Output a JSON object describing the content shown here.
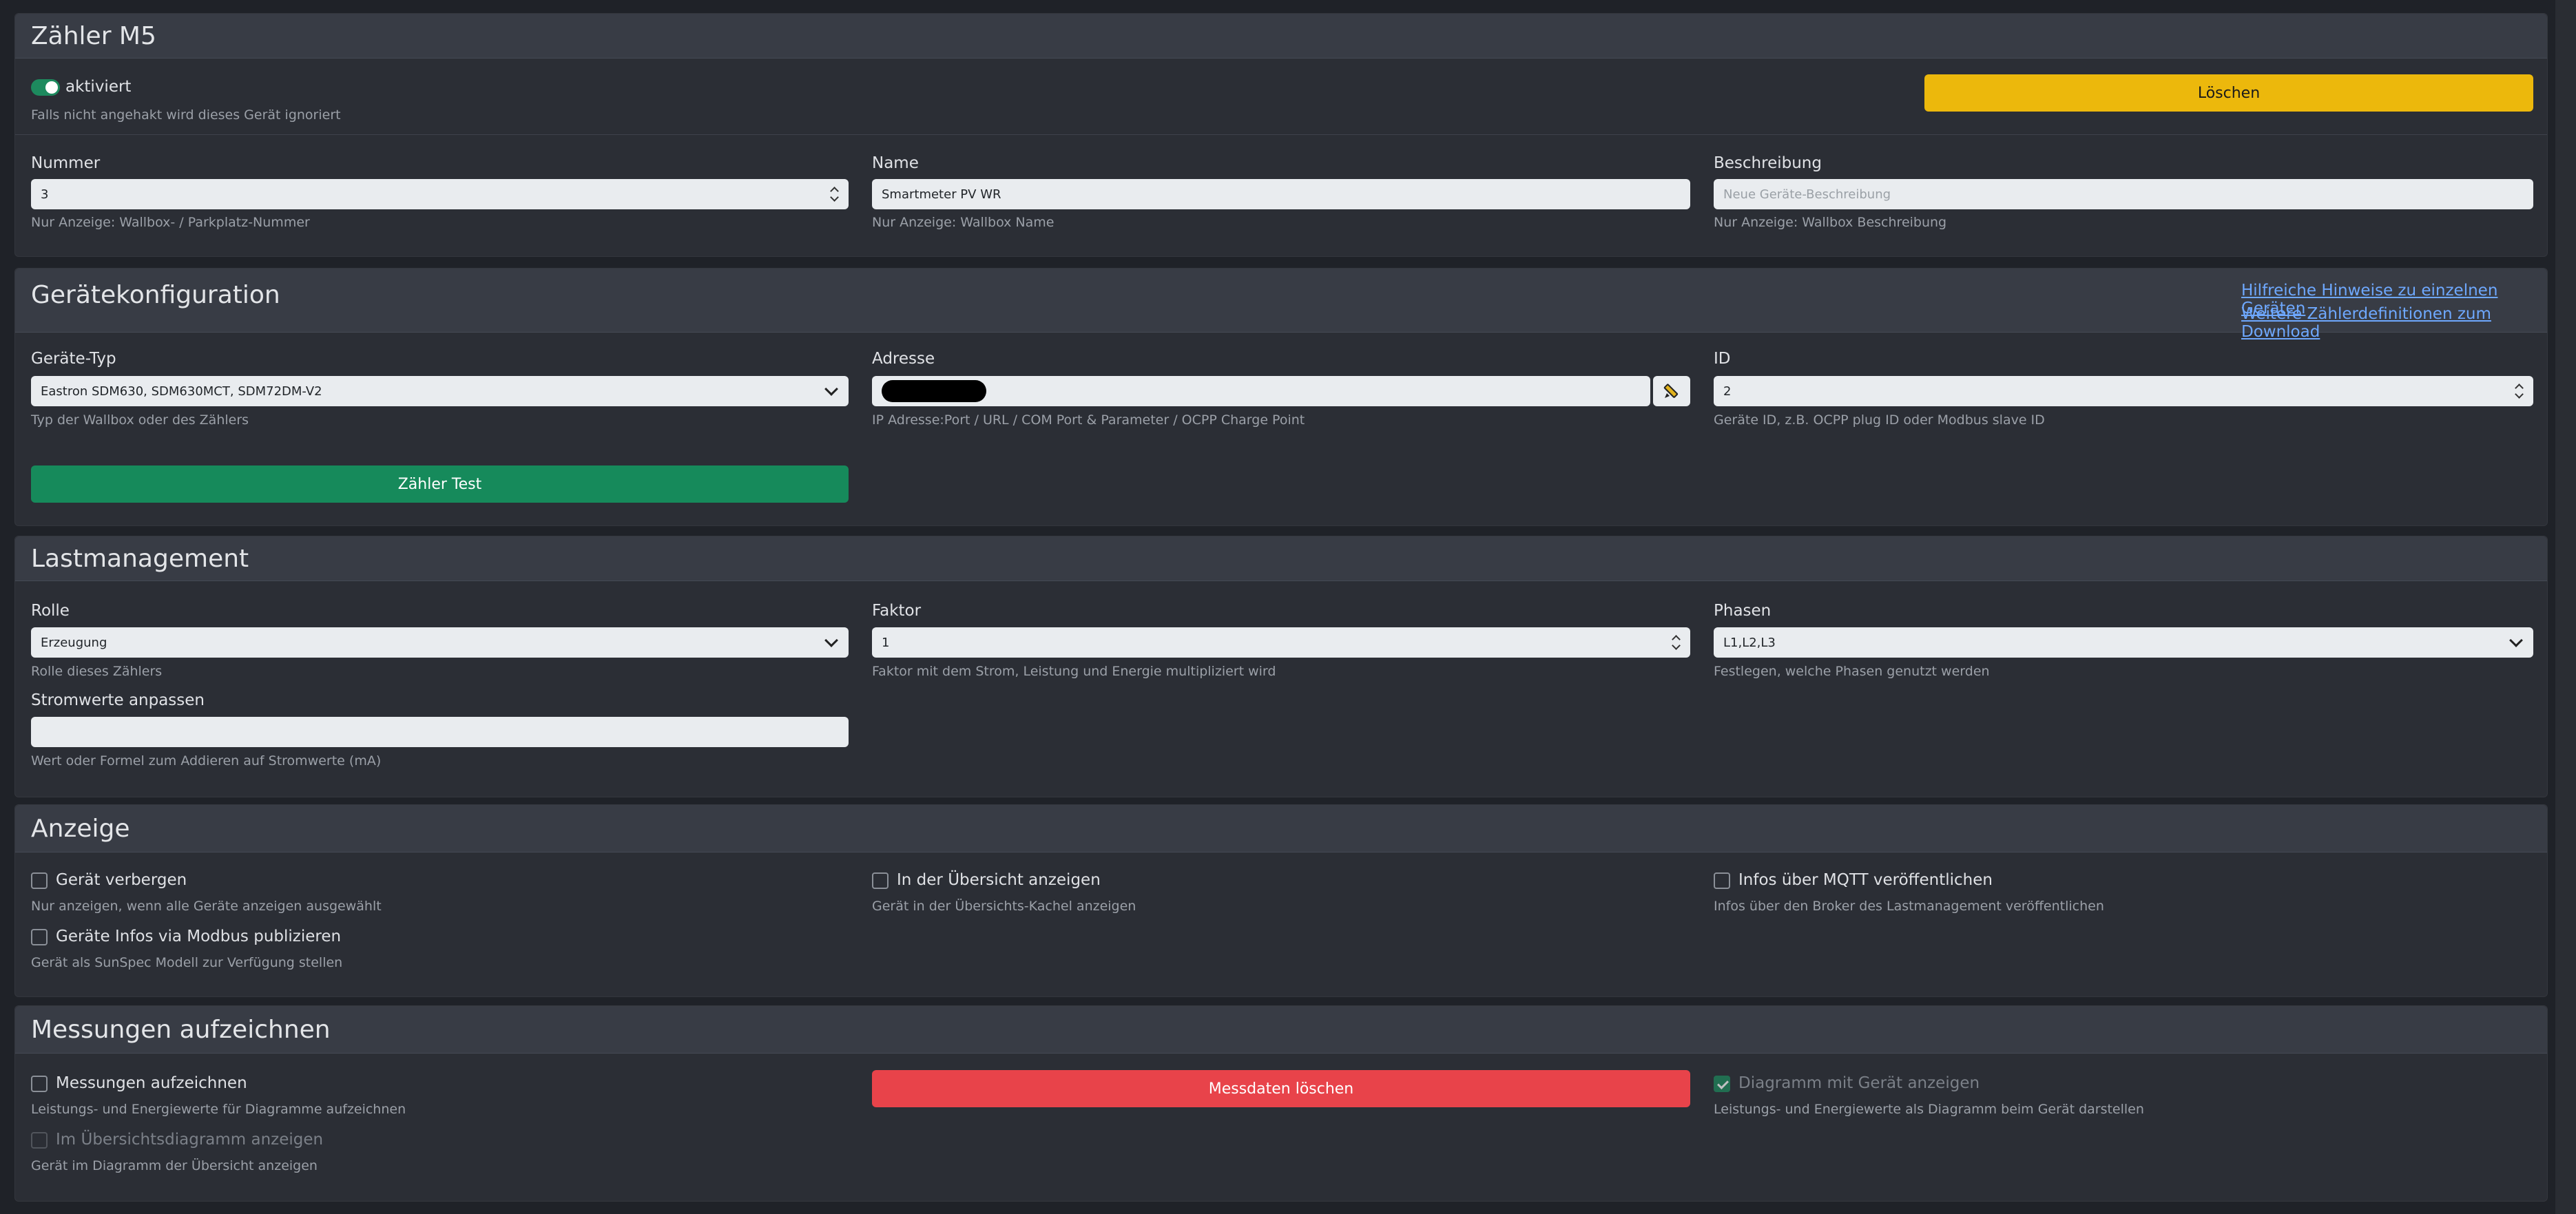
{
  "device": {
    "title": "Zähler M5",
    "active_label": "aktiviert",
    "active_help": "Falls nicht angehakt wird dieses Gerät ignoriert",
    "delete_button": "Löschen",
    "number_label": "Nummer",
    "number_value": "3",
    "number_help": "Nur Anzeige: Wallbox- / Parkplatz-Nummer",
    "name_label": "Name",
    "name_value": "Smartmeter PV WR",
    "name_help": "Nur Anzeige: Wallbox Name",
    "desc_label": "Beschreibung",
    "desc_placeholder": "Neue Geräte-Beschreibung",
    "desc_help": "Nur Anzeige: Wallbox Beschreibung"
  },
  "config": {
    "title": "Gerätekonfiguration",
    "link_hints": "Hilfreiche Hinweise zu einzelnen Geräten",
    "link_download": "Weitere Zählerdefinitionen zum Download",
    "type_label": "Geräte-Typ",
    "type_value": "Eastron SDM630, SDM630MCT, SDM72DM-V2",
    "type_help": "Typ der Wallbox oder des Zählers",
    "address_label": "Adresse",
    "address_help": "IP Adresse:Port / URL / COM Port & Parameter / OCPP Charge Point",
    "id_label": "ID",
    "id_value": "2",
    "id_help": "Geräte ID, z.B. OCPP plug ID oder Modbus slave ID",
    "test_button": "Zähler Test"
  },
  "load": {
    "title": "Lastmanagement",
    "role_label": "Rolle",
    "role_value": "Erzeugung",
    "role_help": "Rolle dieses Zählers",
    "factor_label": "Faktor",
    "factor_value": "1",
    "factor_help": "Faktor mit dem Strom, Leistung und Energie multipliziert wird",
    "phases_label": "Phasen",
    "phases_value": "L1,L2,L3",
    "phases_help": "Festlegen, welche Phasen genutzt werden",
    "current_label": "Stromwerte anpassen",
    "current_help": "Wert oder Formel zum Addieren auf Stromwerte (mA)"
  },
  "display": {
    "title": "Anzeige",
    "hide_label": "Gerät verbergen",
    "hide_help": "Nur anzeigen, wenn alle Geräte anzeigen ausgewählt",
    "overview_label": "In der Übersicht anzeigen",
    "overview_help": "Gerät in der Übersichts-Kachel anzeigen",
    "mqtt_label": "Infos über MQTT veröffentlichen",
    "mqtt_help": "Infos über den Broker des Lastmanagement veröffentlichen",
    "modbus_label": "Geräte Infos via Modbus publizieren",
    "modbus_help": "Gerät als SunSpec Modell zur Verfügung stellen"
  },
  "record": {
    "title": "Messungen aufzeichnen",
    "record_label": "Messungen aufzeichnen",
    "record_help": "Leistungs- und Energiewerte für Diagramme aufzeichnen",
    "delete_button": "Messdaten löschen",
    "diagram_label": "Diagramm mit Gerät anzeigen",
    "diagram_help": "Leistungs- und Energiewerte als Diagramm beim Gerät darstellen",
    "overview_diagram_label": "Im Übersichtsdiagramm anzeigen",
    "overview_diagram_help": "Gerät im Diagramm der Übersicht anzeigen"
  },
  "colors": {
    "warning": "#ecb80c",
    "success": "#168a5b",
    "danger": "#e8434a",
    "link": "#6ea8fe"
  }
}
